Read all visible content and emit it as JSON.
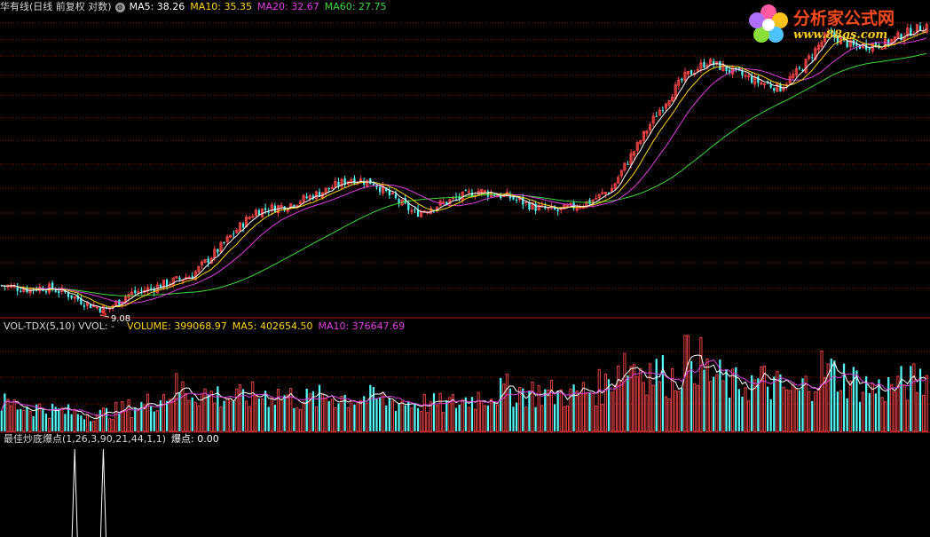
{
  "main_panel": {
    "title": "华有线(日线 前复权 对数)",
    "indicators": [
      {
        "label": "MA5: 38.26",
        "color": "#ffffff"
      },
      {
        "label": "MA10: 35.35",
        "color": "#ffd700"
      },
      {
        "label": "MA20: 32.67",
        "color": "#e040e0"
      },
      {
        "label": "MA60: 27.75",
        "color": "#40d840"
      }
    ],
    "low_label": "9.08"
  },
  "volume_panel": {
    "title": "VOL-TDX(5,10) VVOL: -",
    "indicators": [
      {
        "label": "VOLUME: 399068.97",
        "color": "#ffd700"
      },
      {
        "label": "MA5: 402654.50",
        "color": "#ffd700"
      },
      {
        "label": "MA10: 376647.69",
        "color": "#e040e0"
      }
    ]
  },
  "signal_panel": {
    "title": "最佳炒底爆点(1,26,3,90,21,44,1,1)",
    "indicator": {
      "label": "爆点: 0.00",
      "color": "#ffffff"
    }
  },
  "watermark": {
    "name": "分析家公式网",
    "url": "www.88gs.com"
  },
  "colors": {
    "background": "#000000",
    "up": "#ff4848",
    "down": "#54ffff",
    "ma5": "#ffffff",
    "ma10": "#ffd700",
    "ma20": "#e040e0",
    "ma60": "#40d840",
    "grid": "#7a1010",
    "separator": "#b01818"
  },
  "chart_data": {
    "type": "candlestick",
    "scale": "log",
    "price_anchors": [
      [
        0,
        10.6
      ],
      [
        8,
        10.4
      ],
      [
        14,
        10.5
      ],
      [
        20,
        10.2
      ],
      [
        27,
        9.6
      ],
      [
        33,
        9.3
      ],
      [
        40,
        10.1
      ],
      [
        50,
        10.6
      ],
      [
        60,
        11.2
      ],
      [
        68,
        12.8
      ],
      [
        80,
        15.8
      ],
      [
        90,
        16.3
      ],
      [
        100,
        17.4
      ],
      [
        110,
        18.8
      ],
      [
        117,
        18.4
      ],
      [
        122,
        17.2
      ],
      [
        130,
        15.6
      ],
      [
        140,
        16.6
      ],
      [
        150,
        17.6
      ],
      [
        160,
        17.0
      ],
      [
        168,
        16.1
      ],
      [
        175,
        15.8
      ],
      [
        185,
        16.6
      ],
      [
        192,
        17.8
      ],
      [
        200,
        22.4
      ],
      [
        207,
        27.2
      ],
      [
        215,
        32.5
      ],
      [
        222,
        35.2
      ],
      [
        230,
        33.4
      ],
      [
        238,
        31.6
      ],
      [
        245,
        30.6
      ],
      [
        252,
        34.2
      ],
      [
        260,
        40.8
      ],
      [
        268,
        38.2
      ],
      [
        278,
        38.8
      ],
      [
        285,
        41.2
      ],
      [
        291,
        42.8
      ]
    ],
    "price_ylim": [
      9.0,
      45.0
    ],
    "volume_anchors": [
      [
        0,
        0.34
      ],
      [
        20,
        0.24
      ],
      [
        30,
        0.2
      ],
      [
        45,
        0.32
      ],
      [
        55,
        0.52
      ],
      [
        62,
        0.46
      ],
      [
        75,
        0.4
      ],
      [
        85,
        0.46
      ],
      [
        95,
        0.38
      ],
      [
        105,
        0.42
      ],
      [
        115,
        0.4
      ],
      [
        125,
        0.36
      ],
      [
        140,
        0.32
      ],
      [
        150,
        0.42
      ],
      [
        160,
        0.5
      ],
      [
        170,
        0.46
      ],
      [
        180,
        0.44
      ],
      [
        190,
        0.55
      ],
      [
        195,
        0.86
      ],
      [
        205,
        0.72
      ],
      [
        212,
        0.62
      ],
      [
        216,
        1.05
      ],
      [
        222,
        0.7
      ],
      [
        230,
        0.55
      ],
      [
        240,
        0.6
      ],
      [
        250,
        0.45
      ],
      [
        258,
        0.74
      ],
      [
        265,
        0.66
      ],
      [
        275,
        0.5
      ],
      [
        285,
        0.58
      ],
      [
        291,
        0.62
      ]
    ],
    "volume_ylim": [
      0,
      1.1
    ],
    "signal_spikes": [
      23,
      32
    ]
  }
}
